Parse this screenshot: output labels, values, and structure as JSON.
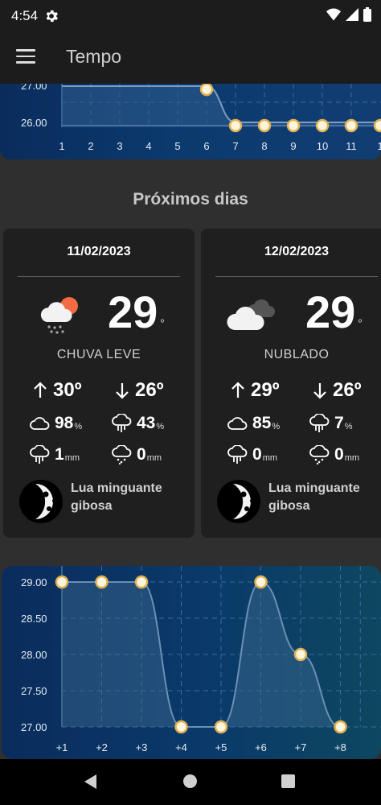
{
  "status_bar": {
    "time": "4:54"
  },
  "app_bar": {
    "title": "Tempo"
  },
  "top_chart": {
    "y_labels": [
      "27.00",
      "26.00"
    ],
    "x_labels": [
      "1",
      "2",
      "3",
      "4",
      "5",
      "6",
      "7",
      "8",
      "9",
      "10",
      "11",
      "1"
    ]
  },
  "section": {
    "title": "Próximos dias"
  },
  "cards": [
    {
      "date": "11/02/2023",
      "temp": "29",
      "temp_unit": "º",
      "condition": "CHUVA LEVE",
      "weather_icon": "rain-sun-icon",
      "max": "30º",
      "min": "26º",
      "humidity": "98",
      "humidity_unit": "%",
      "rain_chance": "43",
      "rain_chance_unit": "%",
      "rain_mm": "1",
      "rain_mm_unit": "mm",
      "snow_mm": "0",
      "snow_mm_unit": "mm",
      "moon_line1": "Lua minguante",
      "moon_line2": "gibosa"
    },
    {
      "date": "12/02/2023",
      "temp": "29",
      "temp_unit": "º",
      "condition": "NUBLADO",
      "weather_icon": "cloudy-icon",
      "max": "29º",
      "min": "26º",
      "humidity": "85",
      "humidity_unit": "%",
      "rain_chance": "7",
      "rain_chance_unit": "%",
      "rain_mm": "0",
      "rain_mm_unit": "mm",
      "snow_mm": "0",
      "snow_mm_unit": "mm",
      "moon_line1": "Lua minguante",
      "moon_line2": "gibosa"
    }
  ],
  "chart_data": {
    "type": "area",
    "x": [
      "+1",
      "+2",
      "+3",
      "+4",
      "+5",
      "+6",
      "+7",
      "+8"
    ],
    "values": [
      29.0,
      29.0,
      29.0,
      27.0,
      27.0,
      29.0,
      28.0,
      27.0
    ],
    "y_ticks": [
      "29.00",
      "28.50",
      "28.00",
      "27.50",
      "27.00"
    ],
    "ylim": [
      27.0,
      29.0
    ],
    "grid": true,
    "line_color": "#6b8fb5",
    "point_fill": "#fff4dc",
    "point_stroke": "#e0b050"
  }
}
